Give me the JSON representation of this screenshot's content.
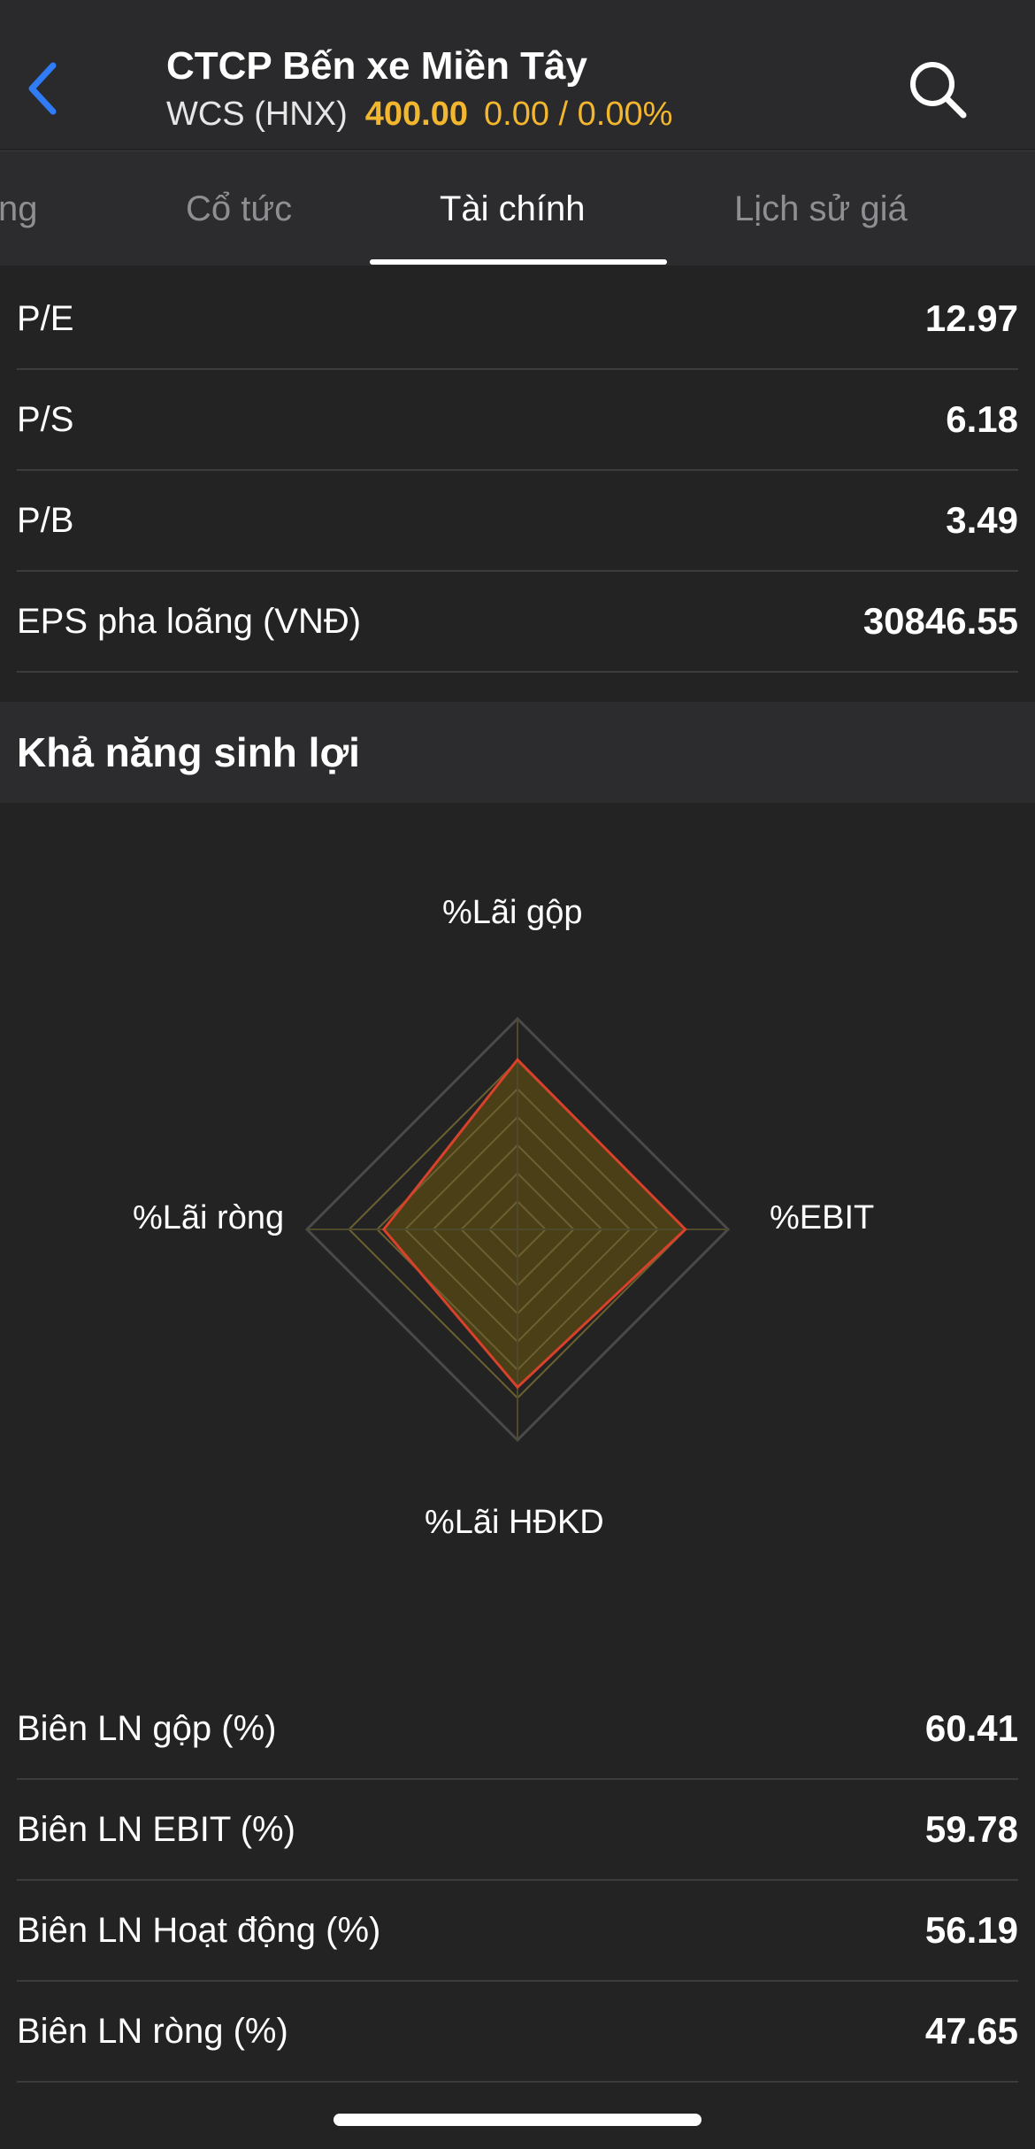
{
  "header": {
    "back_icon": "chevron-left-icon",
    "title": "CTCP Bến xe Miền Tây",
    "ticker": "WCS (HNX)",
    "price": "400.00",
    "change": "0.00 / 0.00%",
    "search_icon": "search-icon",
    "colors": {
      "accent_blue": "#2f7cf6",
      "price_yellow": "#f3b72f"
    }
  },
  "tabs": [
    {
      "label": "ng",
      "active": false
    },
    {
      "label": "Cổ tức",
      "active": false
    },
    {
      "label": "Tài chính",
      "active": true
    },
    {
      "label": "Lịch sử giá",
      "active": false
    }
  ],
  "valuation": [
    {
      "label": "P/E",
      "value": "12.97"
    },
    {
      "label": "P/S",
      "value": "6.18"
    },
    {
      "label": "P/B",
      "value": "3.49"
    },
    {
      "label": "EPS pha loãng (VNĐ)",
      "value": "30846.55"
    }
  ],
  "profitability": {
    "title": "Khả năng sinh lợi",
    "chart_data": {
      "type": "radar",
      "axes": [
        "%Lãi gộp",
        "%EBIT",
        "%Lãi HĐKD",
        "%Lãi ròng"
      ],
      "values": [
        60.41,
        59.78,
        56.19,
        47.65
      ],
      "series_color": "#d8412a",
      "fill_color": "#5a4a14",
      "grid_levels": 6
    },
    "rows": [
      {
        "label": "Biên LN gộp (%)",
        "value": "60.41"
      },
      {
        "label": "Biên LN EBIT (%)",
        "value": "59.78"
      },
      {
        "label": "Biên LN Hoạt động (%)",
        "value": "56.19"
      },
      {
        "label": "Biên LN ròng (%)",
        "value": "47.65"
      }
    ]
  }
}
